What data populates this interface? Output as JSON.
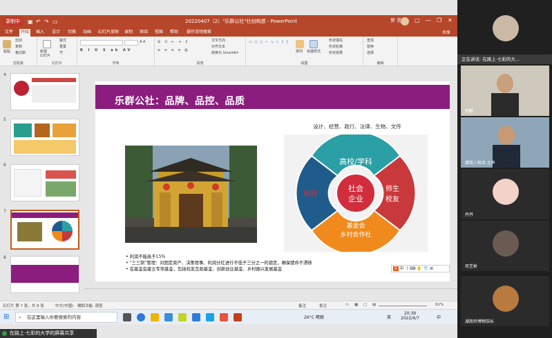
{
  "window": {
    "record_badge": "录制中",
    "title": "20220407（2）\"乐群公社\"社创构想 - PowerPoint",
    "user": "罗 亮",
    "share": "共享"
  },
  "ribbon_tabs": [
    "文件",
    "开始",
    "插入",
    "设计",
    "切换",
    "动画",
    "幻灯片放映",
    "录制",
    "审阅",
    "视图",
    "帮助",
    "操作说明搜索"
  ],
  "ribbon": {
    "clipboard": {
      "paste": "粘贴",
      "cut": "剪切",
      "copy": "复制",
      "format_painter": "格式刷",
      "label": "剪贴板"
    },
    "slides": {
      "new_slide": "新建\n幻灯片",
      "layout": "版式",
      "reset": "重置",
      "section": "节",
      "label": "幻灯片"
    },
    "font": {
      "label": "字体"
    },
    "paragraph": {
      "text_direction": "文字方向",
      "align_text": "对齐文本",
      "smartart": "转换为 SmartArt",
      "label": "段落"
    },
    "drawing": {
      "arrange": "排列",
      "quick_styles": "快速样式",
      "shape_fill": "形状填充",
      "shape_outline": "形状轮廓",
      "shape_effects": "形状效果",
      "label": "绘图"
    },
    "editing": {
      "find": "查找",
      "replace": "替换",
      "select": "选择",
      "label": "编辑"
    }
  },
  "thumbnails": [
    {
      "num": "4"
    },
    {
      "num": "5"
    },
    {
      "num": "6"
    },
    {
      "num": "7",
      "selected": true
    },
    {
      "num": "8"
    }
  ],
  "slide": {
    "title": "乐群公社：品牌、品控、品质",
    "diagram_caption": "设计、经营、政行、法律、生物、文传",
    "center_line1": "社会",
    "center_line2": "企业",
    "seg_top": "高校/学科",
    "seg_right1": "师生",
    "seg_right2": "校友",
    "seg_bottom1": "基金会",
    "seg_bottom2": "乡村合作社",
    "seg_left": "政府",
    "bullets": [
      "利润不能高于15%",
      "\"三三制\"管理：对固定资产、决策理事、利润分红进行不低于三分之一的锁定，确保使命不漂移",
      "在基金会建立专项基金，包括校友互助基金、创新创业基金、乡村振兴发展基金"
    ],
    "ime": "中 ·) ⌨ ✋ 👕 ⊞"
  },
  "colors": {
    "brand": "#b7472a",
    "banner": "#8b1d7e",
    "seg_top": "#2a9fa5",
    "seg_right": "#c9383a",
    "seg_bottom": "#f08a1c",
    "seg_left": "#1f5c8c"
  },
  "statusbar": {
    "slide_info": "幻灯片 第 7 张，共 8 张",
    "lang": "中文(中国)",
    "accessibility": "辅助功能: 调查",
    "notes": "备注",
    "comments": "批注",
    "zoom": "91%"
  },
  "taskbar": {
    "search_placeholder": "在这里输入你要搜索的内容",
    "weather": "26°C 晴朗",
    "time": "20:39",
    "date": "2022/4/7",
    "ime": "英",
    "lang": "中"
  },
  "share_banner": "在路上·七彩的大学的屏幕共享",
  "participants": {
    "speaking": "正在讲话: 在路上·七彩的大...",
    "tiles": [
      {
        "name": "在路上·七彩的大学"
      },
      {
        "name": "徐麒"
      },
      {
        "name": "龚铭 | 陪诗 之声"
      },
      {
        "name": "丹丹"
      },
      {
        "name": "邓艺彬"
      },
      {
        "name": "湖南师博物馆长"
      }
    ]
  }
}
